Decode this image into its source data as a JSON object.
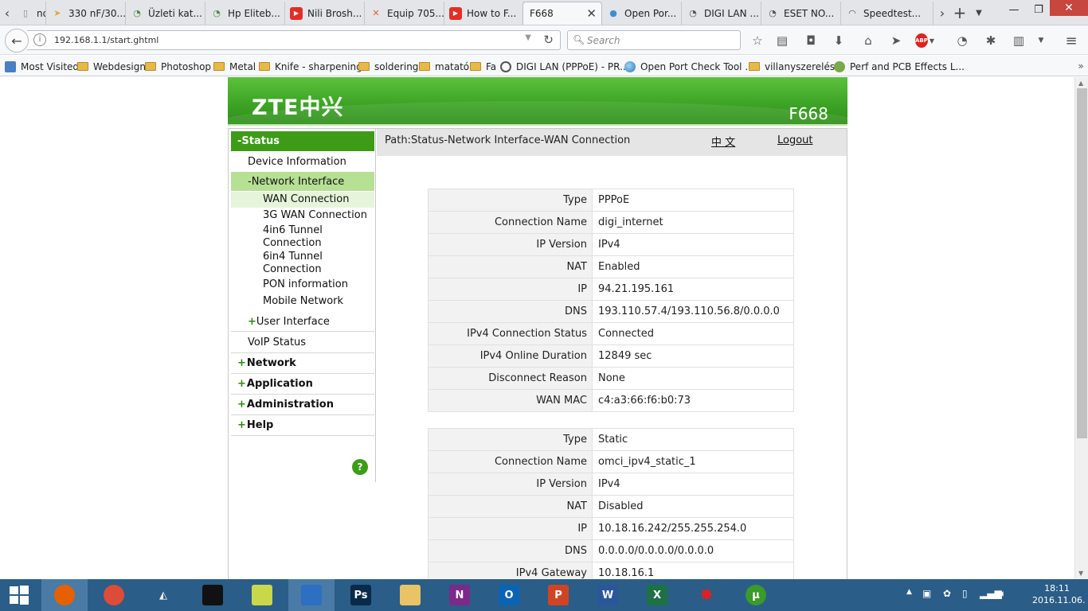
{
  "browser": {
    "tabs": [
      {
        "label": "nd ...",
        "icon": "page-icon",
        "color": "#888888"
      },
      {
        "label": "330 nF/30...",
        "icon": "arrow-icon",
        "color": "#e8a33c"
      },
      {
        "label": "Üzleti kat...",
        "icon": "loading-icon",
        "color": "#4a8a3c"
      },
      {
        "label": "Hp Eliteb...",
        "icon": "loading-icon",
        "color": "#4a8a3c"
      },
      {
        "label": "Nili Brosh...",
        "icon": "youtube-icon",
        "color": "#e52d27"
      },
      {
        "label": "Equip 705...",
        "icon": "close-circle-icon",
        "color": "#e8622c"
      },
      {
        "label": "How to F...",
        "icon": "youtube-icon",
        "color": "#e52d27"
      },
      {
        "label": "F668",
        "icon": "none",
        "color": "#ffffff"
      },
      {
        "label": "Open Por...",
        "icon": "globe-icon",
        "color": "#3b8fd6"
      },
      {
        "label": "DIGI LAN ...",
        "icon": "loading-icon",
        "color": "#555555"
      },
      {
        "label": "ESET NO...",
        "icon": "loading-icon",
        "color": "#555555"
      },
      {
        "label": "Speedtest...",
        "icon": "gauge-icon",
        "color": "#555555"
      }
    ],
    "url": "192.168.1.1/start.ghtml",
    "search_placeholder": "Search",
    "bookmarks": [
      {
        "label": "Most Visited",
        "type": "special"
      },
      {
        "label": "Webdesign",
        "type": "folder"
      },
      {
        "label": "Photoshop",
        "type": "folder"
      },
      {
        "label": "Metal",
        "type": "folder"
      },
      {
        "label": "Knife - sharpening",
        "type": "folder"
      },
      {
        "label": "soldering",
        "type": "folder"
      },
      {
        "label": "matató",
        "type": "folder"
      },
      {
        "label": "Fa",
        "type": "folder"
      },
      {
        "label": "DIGI LAN (PPPoE) - PR...",
        "type": "page"
      },
      {
        "label": "Open Port Check Tool ...",
        "type": "globe"
      },
      {
        "label": "villanyszerelés",
        "type": "folder"
      },
      {
        "label": "Perf and PCB Effects L...",
        "type": "gear"
      }
    ]
  },
  "router": {
    "logo": "ZTE中兴",
    "model": "F668",
    "path": "Path:Status-Network Interface-WAN Connection",
    "lang_link": "中 文",
    "logout": "Logout",
    "help": "?",
    "menu": {
      "status": "-Status",
      "device_information": "Device Information",
      "network_interface": "-Network Interface",
      "wan_connection": "WAN Connection",
      "wan_3g": "3G WAN Connection",
      "tunnel_4in6_a": "4in6 Tunnel",
      "tunnel_4in6_b": "Connection",
      "tunnel_6in4_a": "6in4 Tunnel",
      "tunnel_6in4_b": "Connection",
      "pon_information": "PON information",
      "mobile_network": "Mobile Network",
      "user_interface": "User Interface",
      "voip_status": "VoIP Status",
      "network": "Network",
      "application": "Application",
      "administration": "Administration",
      "help": "Help"
    },
    "connections": [
      {
        "rows": [
          {
            "label": "Type",
            "value": "PPPoE"
          },
          {
            "label": "Connection Name",
            "value": "digi_internet"
          },
          {
            "label": "IP Version",
            "value": "IPv4"
          },
          {
            "label": "NAT",
            "value": "Enabled"
          },
          {
            "label": "IP",
            "value": "94.21.195.161"
          },
          {
            "label": "DNS",
            "value": "193.110.57.4/193.110.56.8/0.0.0.0"
          },
          {
            "label": "IPv4 Connection Status",
            "value": "Connected"
          },
          {
            "label": "IPv4 Online Duration",
            "value": "12849 sec"
          },
          {
            "label": "Disconnect Reason",
            "value": "None"
          },
          {
            "label": "WAN MAC",
            "value": "c4:a3:66:f6:b0:73"
          }
        ]
      },
      {
        "rows": [
          {
            "label": "Type",
            "value": "Static"
          },
          {
            "label": "Connection Name",
            "value": "omci_ipv4_static_1"
          },
          {
            "label": "IP Version",
            "value": "IPv4"
          },
          {
            "label": "NAT",
            "value": "Disabled"
          },
          {
            "label": "IP",
            "value": "10.18.16.242/255.255.254.0"
          },
          {
            "label": "DNS",
            "value": "0.0.0.0/0.0.0.0/0.0.0.0"
          },
          {
            "label": "IPv4 Gateway",
            "value": "10.18.16.1"
          }
        ]
      }
    ]
  },
  "taskbar": {
    "apps": [
      {
        "name": "firefox",
        "glyph": "",
        "color": "#e66000",
        "active": true
      },
      {
        "name": "chrome",
        "glyph": "",
        "color": "#dd4b39",
        "active": false
      },
      {
        "name": "alien",
        "glyph": "",
        "color": "#dddddd",
        "active": false
      },
      {
        "name": "terminal",
        "glyph": "",
        "color": "#111111",
        "active": false
      },
      {
        "name": "notepad",
        "glyph": "",
        "color": "#c8d84a",
        "active": false
      },
      {
        "name": "floppy",
        "glyph": "",
        "color": "#2d6fc0",
        "active": true
      },
      {
        "name": "photoshop",
        "glyph": "Ps",
        "color": "#0a2a4a",
        "active": false
      },
      {
        "name": "explorer",
        "glyph": "",
        "color": "#e8c464",
        "active": false
      },
      {
        "name": "onenote",
        "glyph": "N",
        "color": "#7b2a8a",
        "active": false
      },
      {
        "name": "outlook",
        "glyph": "O",
        "color": "#0a64b4",
        "active": false
      },
      {
        "name": "powerpoint",
        "glyph": "P",
        "color": "#d04424",
        "active": false
      },
      {
        "name": "word",
        "glyph": "W",
        "color": "#2b579a",
        "active": false
      },
      {
        "name": "excel",
        "glyph": "X",
        "color": "#1e7145",
        "active": false
      },
      {
        "name": "splatter",
        "glyph": "",
        "color": "#e02020",
        "active": false
      },
      {
        "name": "utorrent",
        "glyph": "µ",
        "color": "#3a9a2a",
        "active": false
      }
    ],
    "time": "18:11",
    "date": "2016.11.06."
  }
}
